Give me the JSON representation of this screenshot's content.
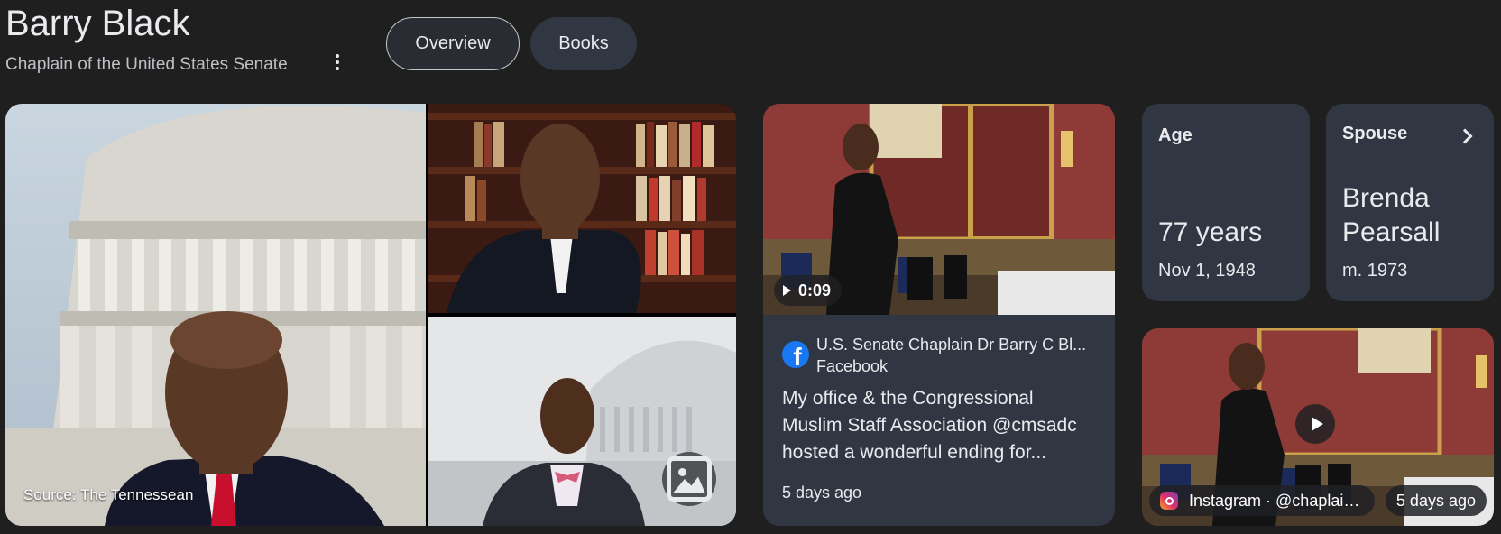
{
  "entity": {
    "name": "Barry Black",
    "description": "Chaplain of the United States Senate"
  },
  "tabs": [
    {
      "label": "Overview",
      "selected": true
    },
    {
      "label": "Books",
      "selected": false
    }
  ],
  "images": {
    "source_label": "Source: The Tennessean"
  },
  "video": {
    "duration": "0:09",
    "source_title": "U.S. Senate Chaplain Dr Barry C Bl...",
    "source_site": "Facebook",
    "description": "My office & the Congressional Muslim Staff Association @cmsadc hosted a wonderful ending for...",
    "time_ago": "5 days ago"
  },
  "facts": {
    "age": {
      "label": "Age",
      "value": "77 years",
      "sub": "Nov 1, 1948"
    },
    "spouse": {
      "label": "Spouse",
      "value_line1": "Brenda",
      "value_line2": "Pearsall",
      "sub": "m. 1973"
    }
  },
  "instagram": {
    "source": "Instagram · @chaplain...",
    "time_ago": "5 days ago"
  },
  "colors": {
    "background": "#1f1f1f",
    "card": "#303642",
    "text": "#e8eaed",
    "facebook": "#1877f2"
  }
}
